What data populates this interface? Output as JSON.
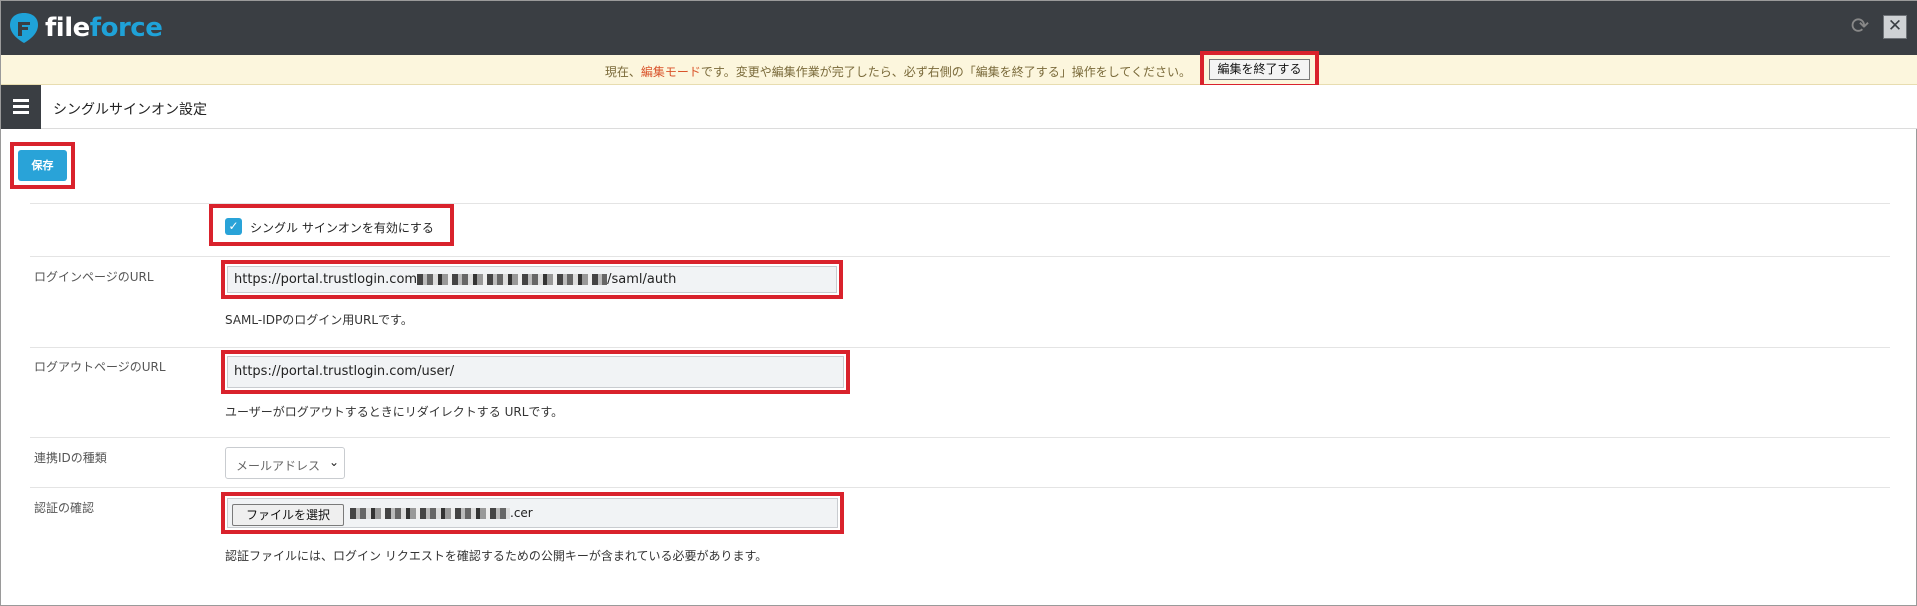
{
  "app": {
    "logo_file": "file",
    "logo_force": "force",
    "brand_color": "#1fa2d8"
  },
  "banner": {
    "text_before": "現在、",
    "text_highlight": "編集モード",
    "text_after": "です。変更や編集作業が完了したら、必ず右側の「編集を終了する」操作をしてください。",
    "end_edit_label": "編集を終了する"
  },
  "header": {
    "title": "シングルサインオン設定"
  },
  "toolbar": {
    "save_label": "保存"
  },
  "form": {
    "sso_enable": {
      "label": "シングル サインオンを有効にする",
      "checked": true
    },
    "login_url": {
      "label": "ログインページのURL",
      "value_prefix": "https://portal.trustlogin.com",
      "value_suffix": "/saml/auth",
      "help": "SAML-IDPのログイン用URLです。"
    },
    "logout_url": {
      "label": "ログアウトページのURL",
      "value": "https://portal.trustlogin.com/user/",
      "help": "ユーザーがログアウトするときにリダイレクトする URLです。"
    },
    "id_type": {
      "label": "連携IDの種類",
      "selected": "メールアドレス"
    },
    "certificate": {
      "label": "認証の確認",
      "file_button": "ファイルを選択",
      "file_name_suffix": ".cer",
      "help": "認証ファイルには、ログイン リクエストを確認するための公開キーが含まれている必要があります。"
    }
  },
  "icons": {
    "logo": "fileforce-logo-icon",
    "refresh": "refresh-icon",
    "close": "close-icon",
    "menu": "hamburger-menu-icon",
    "checkbox": "checkmark-icon",
    "select": "chevron-down-icon"
  },
  "colors": {
    "topbar": "#3a3e43",
    "accent": "#29a3d8",
    "banner_bg": "#fcf6dd",
    "highlight_box": "#d9222c"
  }
}
